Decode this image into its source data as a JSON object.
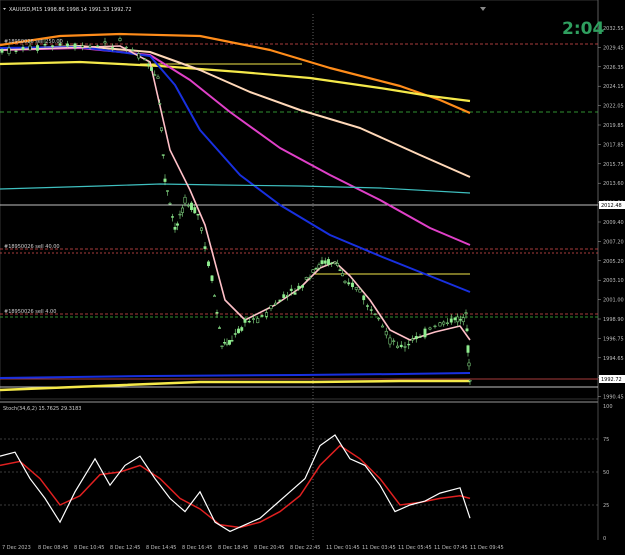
{
  "header": {
    "symbol_line": "XAUUSD,M15  1998.86 1998.14 1991.33 1992.72",
    "clock": "2:04",
    "chevron_icon": "chevron-down-icon"
  },
  "labels": {
    "mid_label_1": "#18950026 sell 4.00",
    "stoch_label": "Stoch(34,6,2) 15.7625 29.3183"
  },
  "price_axis": {
    "ticks": [
      "2032.55",
      "2029.45",
      "2026.35",
      "2024.15",
      "2022.05",
      "2019.85",
      "2017.85",
      "2015.75",
      "2013.60",
      "2011.50",
      "2009.40",
      "2007.20",
      "2005.20",
      "2003.10",
      "2001.00",
      "1998.90",
      "1996.75",
      "1994.65",
      "1992.55",
      "1990.45"
    ],
    "current_price_tag": "1992.72",
    "level_tag": "2012.48"
  },
  "stoch_axis": {
    "ticks": [
      "100",
      "75",
      "50",
      "25",
      "0"
    ]
  },
  "time_axis": {
    "ticks": [
      "7 Dec 2023",
      "8 Dec 08:45",
      "8 Dec 10:45",
      "8 Dec 12:45",
      "8 Dec 14:45",
      "8 Dec 16:45",
      "8 Dec 18:45",
      "8 Dec 20:45",
      "8 Dec 22:45",
      "11 Dec 01:45",
      "11 Dec 03:45",
      "11 Dec 05:45",
      "11 Dec 07:45",
      "11 Dec 09:45"
    ]
  },
  "colors": {
    "background": "#000000",
    "bull_candle": "#90ee90",
    "bear_candle": "#90ee90",
    "ma_orange": "#ff8c1a",
    "ma_yellow": "#f5e94a",
    "ma_peach": "#ffd8b8",
    "ma_magenta": "#e040c8",
    "ma_blue": "#1830e0",
    "ma_cyan": "#3fc0c0",
    "ma_pink": "#ffc0c8",
    "stoch_main": "#ffffff",
    "stoch_signal": "#e02020",
    "sell_line": "#e05050",
    "buy_line": "#40c040"
  }
}
